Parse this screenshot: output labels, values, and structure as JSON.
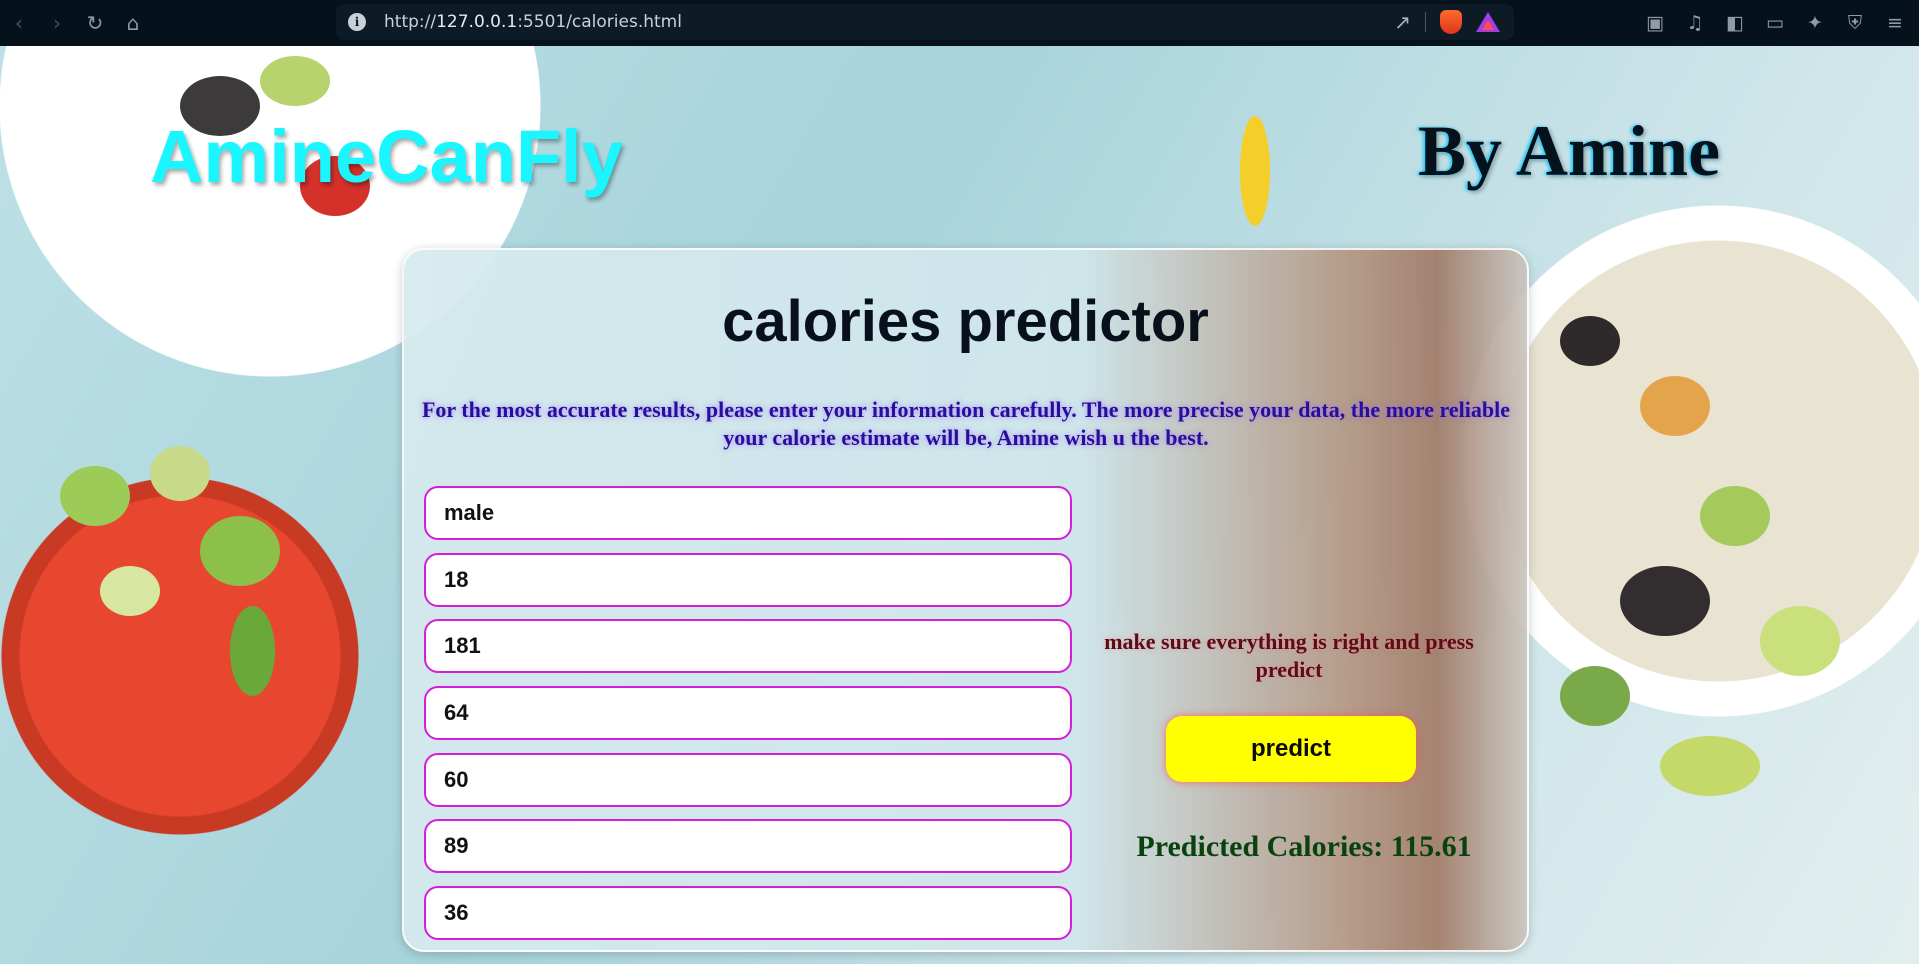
{
  "browser": {
    "url_prefix": "http://",
    "url_host": "127.0.0.1",
    "url_rest": ":5501/calories.html",
    "icons": [
      "back-icon",
      "forward-icon",
      "reload-icon",
      "home-icon",
      "site-info-icon",
      "share-icon",
      "brave-shields-icon",
      "brave-rewards-icon",
      "reader-mode-icon",
      "media-icon",
      "sidebar-icon",
      "wallet-icon",
      "leo-ai-icon",
      "vpn-icon",
      "menu-icon"
    ]
  },
  "header": {
    "brand": "AmineCanFly",
    "byline": "By Amine"
  },
  "card": {
    "title": "calories predictor",
    "description": "For the most accurate results, please enter your information carefully. The more precise your data, the more reliable your calorie estimate will be, Amine wish u the best.",
    "fields": [
      {
        "value": "male"
      },
      {
        "value": "18"
      },
      {
        "value": "181"
      },
      {
        "value": "64"
      },
      {
        "value": "60"
      },
      {
        "value": "89"
      },
      {
        "value": "36"
      }
    ],
    "hint": "make sure everything is right and press predict",
    "predict_label": "predict",
    "result": "Predicted Calories: 115.61"
  },
  "colors": {
    "brand": "#19f6ff",
    "field_border": "#d41fd8",
    "button_bg": "#ffff00",
    "description": "#24109a",
    "hint": "#5a0d15",
    "result": "#07420f"
  }
}
